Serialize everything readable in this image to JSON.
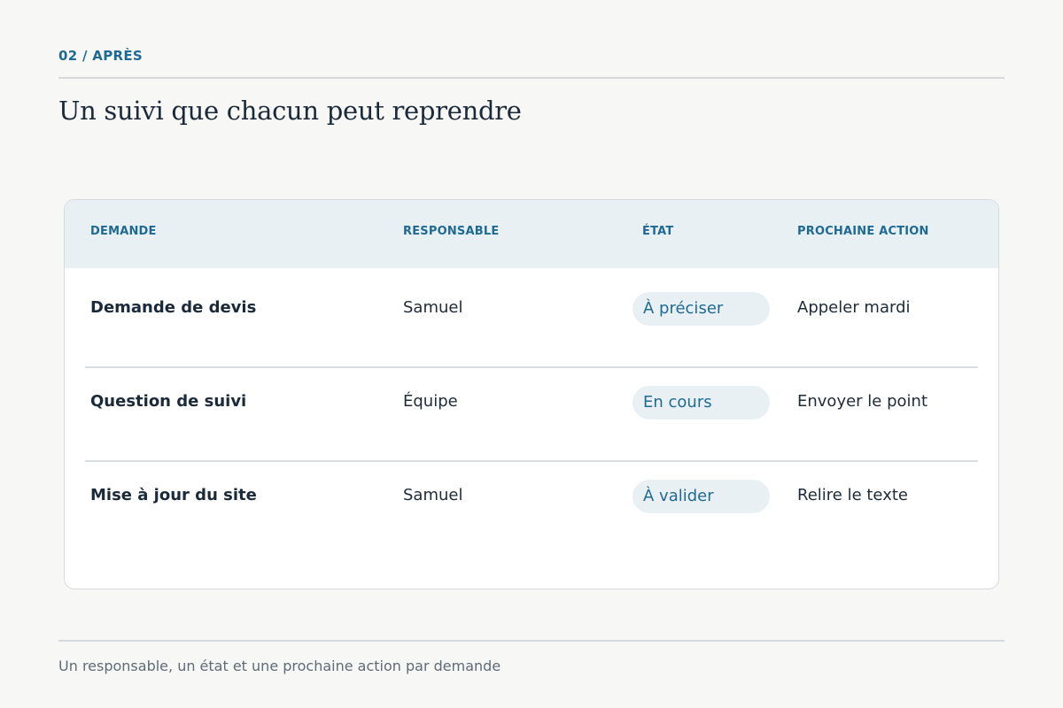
{
  "header": {
    "eyebrow": "02 / APRÈS",
    "title": "Un suivi que chacun peut reprendre"
  },
  "table": {
    "columns": [
      "DEMANDE",
      "RESPONSABLE",
      "ÉTAT",
      "PROCHAINE ACTION"
    ],
    "rows": [
      {
        "demande": "Demande de devis",
        "responsable": "Samuel",
        "etat": "À préciser",
        "action": "Appeler mardi"
      },
      {
        "demande": "Question de suivi",
        "responsable": "Équipe",
        "etat": "En cours",
        "action": "Envoyer le point"
      },
      {
        "demande": "Mise à jour du site",
        "responsable": "Samuel",
        "etat": "À valider",
        "action": "Relire le texte"
      }
    ]
  },
  "footer": {
    "note": "Un responsable, un état et une prochaine action par demande"
  },
  "colors": {
    "accent": "#1f6a93",
    "background": "#f7f7f5",
    "header_fill": "#e9f0f4",
    "text": "#1b2a3a"
  }
}
